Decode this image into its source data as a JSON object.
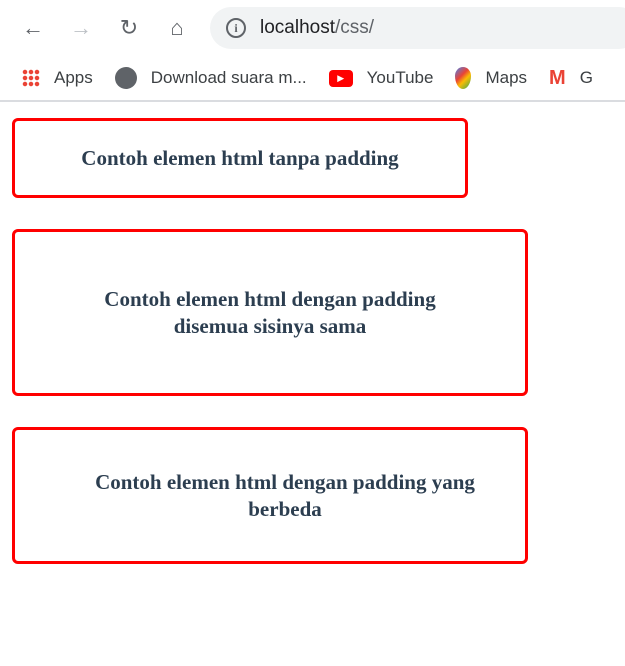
{
  "browser": {
    "url_host": "localhost",
    "url_path": "/css/",
    "bookmarks": [
      {
        "label": "Apps",
        "icon": "apps-grid-icon"
      },
      {
        "label": "Download suara m...",
        "icon": "globe-icon"
      },
      {
        "label": "YouTube",
        "icon": "youtube-icon"
      },
      {
        "label": "Maps",
        "icon": "maps-pin-icon"
      },
      {
        "label": "G",
        "icon": "gmail-icon"
      }
    ]
  },
  "page": {
    "boxes": [
      {
        "text": "Contoh elemen html tanpa padding"
      },
      {
        "text": "Contoh elemen html dengan padding disemua sisinya sama"
      },
      {
        "text": "Contoh elemen html dengan padding yang berbeda"
      }
    ],
    "border_color": "#ff0000",
    "text_color": "#2c3e50"
  }
}
